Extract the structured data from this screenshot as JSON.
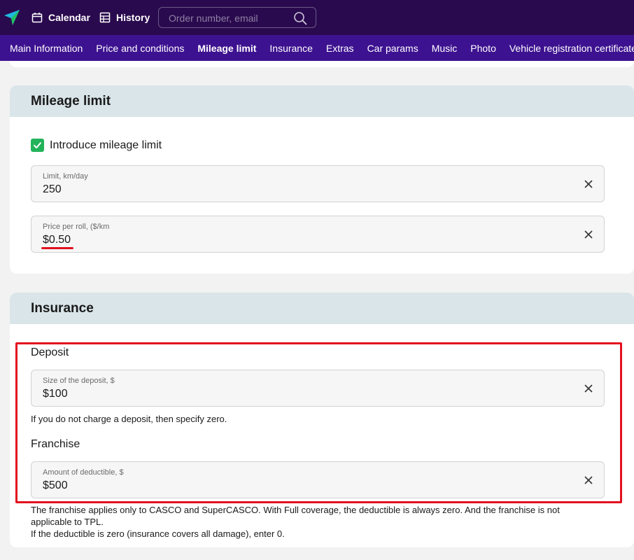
{
  "topbar": {
    "calendar_label": "Calendar",
    "history_label": "History",
    "search_placeholder": "Order number, email",
    "bg_color": "#2a0a4e"
  },
  "tabs": [
    {
      "label": "Main Information",
      "active": false
    },
    {
      "label": "Price and conditions",
      "active": false
    },
    {
      "label": "Mileage limit",
      "active": true
    },
    {
      "label": "Insurance",
      "active": false
    },
    {
      "label": "Extras",
      "active": false
    },
    {
      "label": "Car params",
      "active": false
    },
    {
      "label": "Music",
      "active": false
    },
    {
      "label": "Photo",
      "active": false
    },
    {
      "label": "Vehicle registration certificate",
      "active": false
    }
  ],
  "mileage": {
    "title": "Mileage limit",
    "checkbox_label": "Introduce mileage limit",
    "checkbox_checked": true,
    "limit_label": "Limit, km/day",
    "limit_value": "250",
    "price_label": "Price per roll, ($/km",
    "price_value": "$0.50"
  },
  "insurance": {
    "title": "Insurance",
    "deposit_heading": "Deposit",
    "deposit_label": "Size of the deposit, $",
    "deposit_value": "$100",
    "deposit_hint": "If you do not charge a deposit, then specify zero.",
    "franchise_heading": "Franchise",
    "deductible_label": "Amount of deductible, $",
    "deductible_value": "$500",
    "franchise_hint_1": "The franchise applies only to CASCO and SuperCASCO. With Full coverage, the deductible is always zero. And the franchise is not",
    "franchise_hint_2": "applicable to TPL.",
    "franchise_hint_3": "If the deductible is zero (insurance covers all damage), enter 0."
  },
  "colors": {
    "tabs_bg": "#3d1290",
    "section_header_bg": "#dae5e9",
    "checkbox_green": "#23b35a",
    "highlight_red": "#e3101e"
  }
}
